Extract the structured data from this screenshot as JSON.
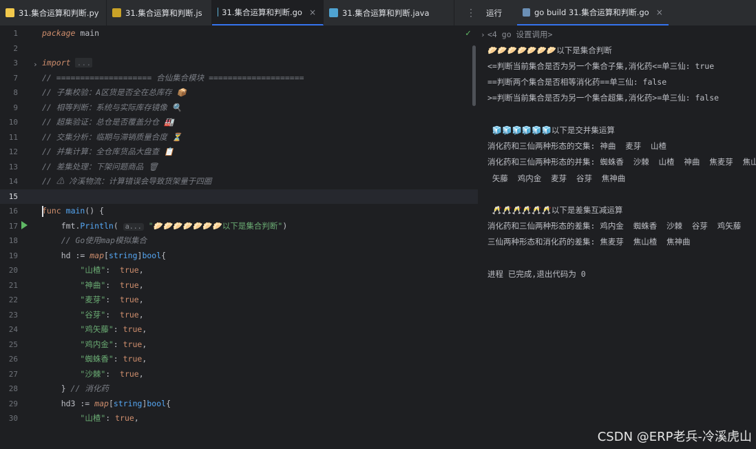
{
  "tabs": [
    {
      "label": "31.集合运算和判断.py",
      "icon_color": "#f2c94c",
      "icon": "python-icon"
    },
    {
      "label": "31.集合运算和判断.js",
      "icon_color": "#c9a227",
      "icon": "javascript-icon"
    },
    {
      "label": "31.集合运算和判断.go",
      "icon_color": "#5fb3d9",
      "icon": "go-icon",
      "active": true,
      "close": "×"
    },
    {
      "label": "31.集合运算和判断.java",
      "icon_color": "#4fa3d1",
      "icon": "java-icon"
    }
  ],
  "more_tabs": "⋮",
  "run_panel": {
    "title": "运行",
    "tab_label": "go build 31.集合运算和判断.go",
    "tab_close": "×"
  },
  "editor": {
    "lines": [
      {
        "n": "1",
        "html": "<span class='kw'>package</span> <span class='ident'>main</span>"
      },
      {
        "n": "2",
        "html": ""
      },
      {
        "n": "3",
        "html": "<span class='kw'>import</span> <span class='fold'>...</span>"
      },
      {
        "n": "7",
        "html": "<span class='cm'>// ==================== 合仙集合模块 ====================</span>"
      },
      {
        "n": "8",
        "html": "<span class='cm'>// 子集校验：A区货是否全在总库存 📦</span>"
      },
      {
        "n": "9",
        "html": "<span class='cm'>// 相等判断：系统与实际库存镜像 🔍</span>"
      },
      {
        "n": "10",
        "html": "<span class='cm'>// 超集验证：总仓是否覆盖分仓 🏭</span>"
      },
      {
        "n": "11",
        "html": "<span class='cm'>// 交集分析：临期与滞销质量合度 ⏳</span>"
      },
      {
        "n": "12",
        "html": "<span class='cm'>// 并集计算：全仓库货品大盘查 📋</span>"
      },
      {
        "n": "13",
        "html": "<span class='cm'>// 差集处理：下架问题商品 🗑</span>"
      },
      {
        "n": "14",
        "html": "<span class='cm'>// ⚠ 冷溪物流：计算错误会导致货架量于四圈</span>"
      },
      {
        "n": "15",
        "html": "",
        "current": true
      },
      {
        "n": "16",
        "html": "<span class='kwn'>func</span> <span class='fn'>main</span>() {"
      },
      {
        "n": "17",
        "html": "    fmt.<span class='fn'>Println</span>( <span class='hint'>a...</span> <span class='str'>\"🥟🥟🥟🥟🥟🥟🥟以下是集合判断\"</span>)"
      },
      {
        "n": "18",
        "html": "    <span class='cm'>// Go使用map模拟集合</span>"
      },
      {
        "n": "19",
        "html": "    hd := <span class='kw'>map</span>[<span class='fn'>string</span>]<span class='fn'>bool</span>{"
      },
      {
        "n": "20",
        "html": "        <span class='str'>\"山楂\"</span>:  <span class='kwn'>true</span>,"
      },
      {
        "n": "21",
        "html": "        <span class='str'>\"神曲\"</span>:  <span class='kwn'>true</span>,"
      },
      {
        "n": "22",
        "html": "        <span class='str'>\"麦芽\"</span>:  <span class='kwn'>true</span>,"
      },
      {
        "n": "23",
        "html": "        <span class='str'>\"谷芽\"</span>:  <span class='kwn'>true</span>,"
      },
      {
        "n": "24",
        "html": "        <span class='str'>\"鸡矢藤\"</span>: <span class='kwn'>true</span>,"
      },
      {
        "n": "25",
        "html": "        <span class='str'>\"鸡内金\"</span>: <span class='kwn'>true</span>,"
      },
      {
        "n": "26",
        "html": "        <span class='str'>\"蜘蛛香\"</span>: <span class='kwn'>true</span>,"
      },
      {
        "n": "27",
        "html": "        <span class='str'>\"沙棘\"</span>:  <span class='kwn'>true</span>,"
      },
      {
        "n": "28",
        "html": "    } <span class='cm'>// 消化药</span>"
      },
      {
        "n": "29",
        "html": "    hd3 := <span class='kw'>map</span>[<span class='fn'>string</span>]<span class='fn'>bool</span>{"
      },
      {
        "n": "30",
        "html": "        <span class='str'>\"山楂\"</span>: <span class='kwn'>true</span>,"
      }
    ]
  },
  "console": {
    "lines": [
      {
        "text": "<4 go 设置调用>",
        "gray": true
      },
      {
        "text": "🥟🥟🥟🥟🥟🥟🥟以下是集合判断"
      },
      {
        "text": "<=判断当前集合是否为另一个集合子集,消化药<=单三仙: true"
      },
      {
        "text": "==判断两个集合是否相等消化药==单三仙: false"
      },
      {
        "text": ">=判断当前集合是否为另一个集合超集,消化药>=单三仙: false"
      },
      {
        "text": ""
      },
      {
        "text": " 🧊🧊🧊🧊🧊🧊以下是交并集运算"
      },
      {
        "text": "消化药和三仙两种形态的交集: 神曲  麦芽  山楂"
      },
      {
        "text": "消化药和三仙两种形态的并集: 蜘蛛香  沙棘  山楂  神曲  焦麦芽  焦山楂  鸡"
      },
      {
        "text": " 矢藤  鸡内金  麦芽  谷芽  焦神曲"
      },
      {
        "text": ""
      },
      {
        "text": " 🥂🥂🥂🥂🥂🥂以下是差集互减运算"
      },
      {
        "text": "消化药和三仙两种形态的差集: 鸡内金  蜘蛛香  沙棘  谷芽  鸡矢藤"
      },
      {
        "text": "三仙两种形态和消化药的差集: 焦麦芽  焦山楂  焦神曲"
      },
      {
        "text": ""
      },
      {
        "text": "进程 已完成,退出代码为 0"
      }
    ]
  },
  "watermark": "CSDN @ERP老兵-冷溪虎山"
}
